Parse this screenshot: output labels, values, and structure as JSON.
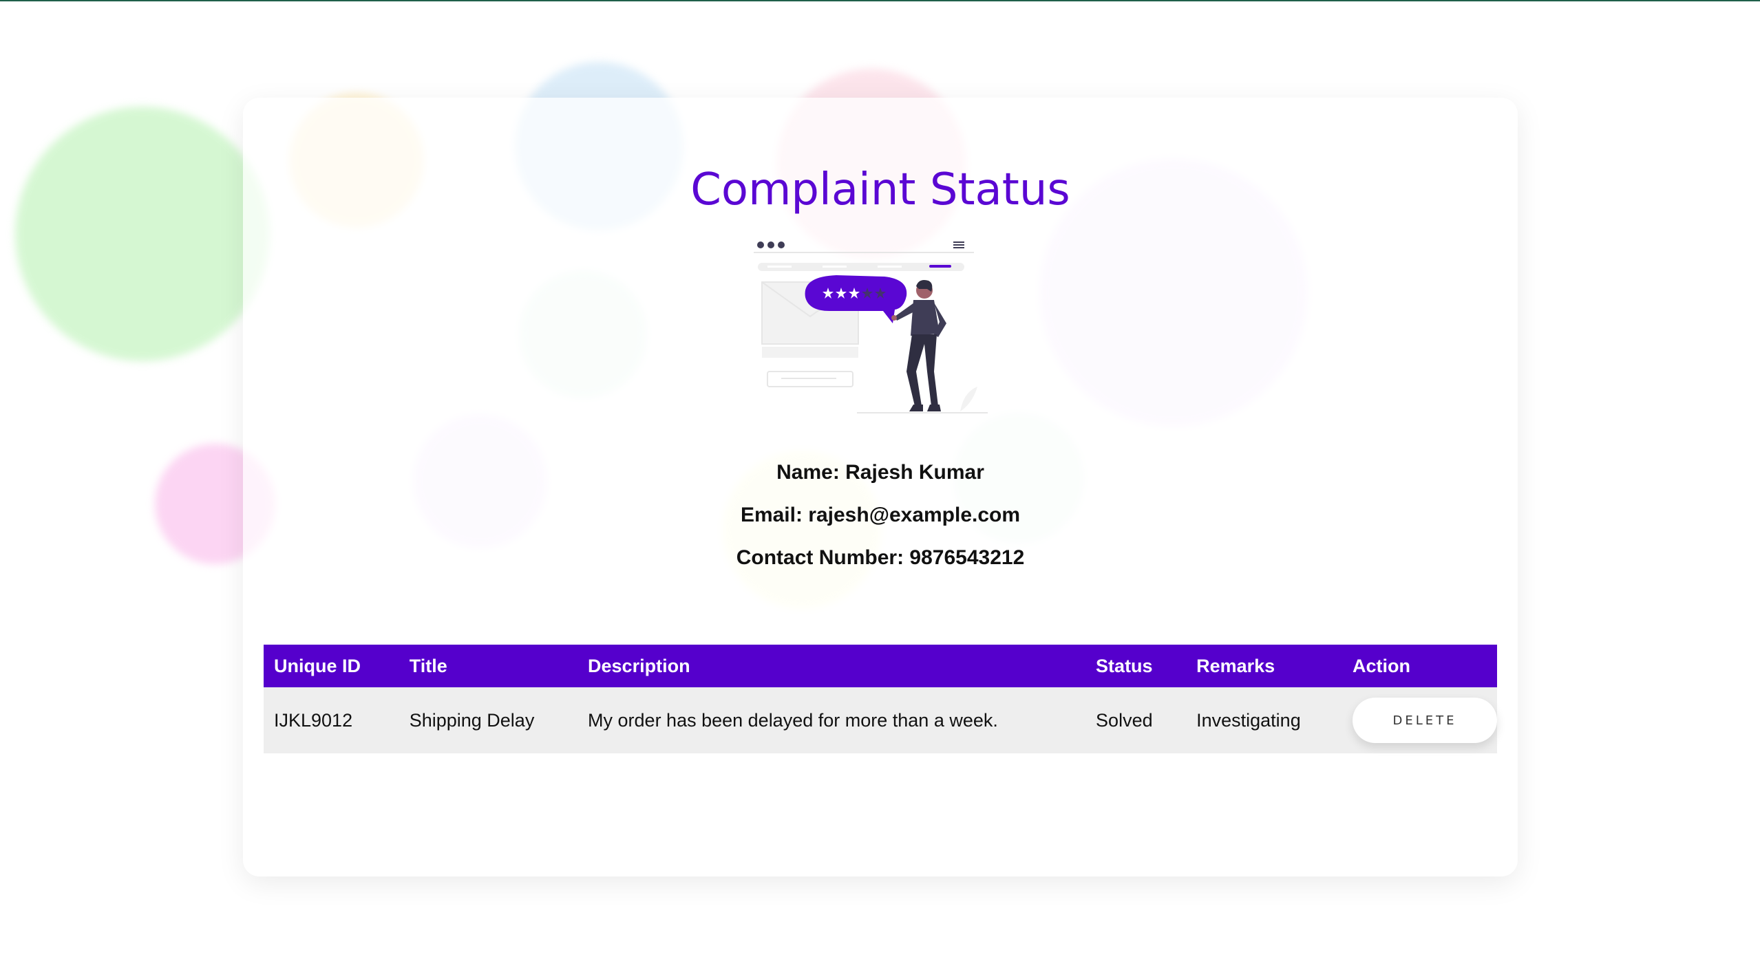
{
  "page": {
    "title": "Complaint Status"
  },
  "user": {
    "name_line": "Name: Rajesh Kumar",
    "email_line": "Email: rajesh@example.com",
    "contact_line": "Contact Number: 9876543212"
  },
  "table": {
    "headers": [
      "Unique ID",
      "Title",
      "Description",
      "Status",
      "Remarks",
      "Action"
    ],
    "rows": [
      {
        "unique_id": "IJKL9012",
        "title": "Shipping Delay",
        "description": "My order has been delayed for more than a week.",
        "status": "Solved",
        "remarks": "Investigating",
        "action_label": "DELETE"
      }
    ]
  },
  "colors": {
    "accent": "#5500cc",
    "title": "#5a07d3",
    "row_background": "#eeeeee",
    "background_bubbles": [
      "#c8f5c4",
      "#fde9b8",
      "#cfe6f7",
      "#fbd3df",
      "#eedcfb",
      "#dcf2e6",
      "#fbc4ee",
      "#fbfbcf"
    ]
  },
  "icons": {
    "illustration": "person-with-rating-speech-bubble-illustration"
  }
}
